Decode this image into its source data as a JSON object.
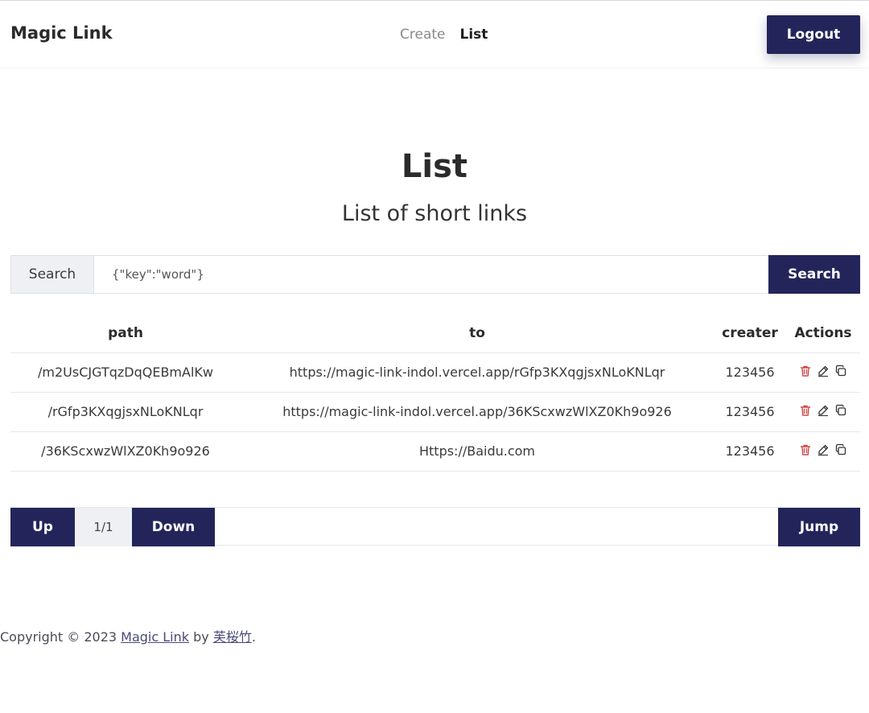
{
  "colors": {
    "accent": "#23255a",
    "danger": "#d14b4b",
    "icon": "#333333"
  },
  "header": {
    "brand": "Magic Link",
    "nav": [
      {
        "label": "Create",
        "active": false
      },
      {
        "label": "List",
        "active": true
      }
    ],
    "logout_label": "Logout"
  },
  "hero": {
    "title": "List",
    "subtitle": "List of short links"
  },
  "search": {
    "label": "Search",
    "value": "{\"key\":\"word\"}",
    "button_label": "Search"
  },
  "table": {
    "columns": [
      "path",
      "to",
      "creater",
      "Actions"
    ],
    "rows": [
      {
        "path": "/m2UsCJGTqzDqQEBmAlKw",
        "to": "https://magic-link-indol.vercel.app/rGfp3KXqgjsxNLoKNLqr",
        "creater": "123456"
      },
      {
        "path": "/rGfp3KXqgjsxNLoKNLqr",
        "to": "https://magic-link-indol.vercel.app/36KScxwzWlXZ0Kh9o926",
        "creater": "123456"
      },
      {
        "path": "/36KScxwzWlXZ0Kh9o926",
        "to": "Https://Baidu.com",
        "creater": "123456"
      }
    ],
    "action_icons": [
      "trash-icon",
      "edit-icon",
      "copy-icon"
    ]
  },
  "pagination": {
    "up_label": "Up",
    "page_indicator": "1/1",
    "down_label": "Down",
    "jump_value": "",
    "jump_label": "Jump"
  },
  "footer": {
    "prefix": "Copyright © 2023 ",
    "link1": "Magic Link",
    "middle": " by ",
    "link2": "芙桜竹",
    "suffix": "."
  }
}
